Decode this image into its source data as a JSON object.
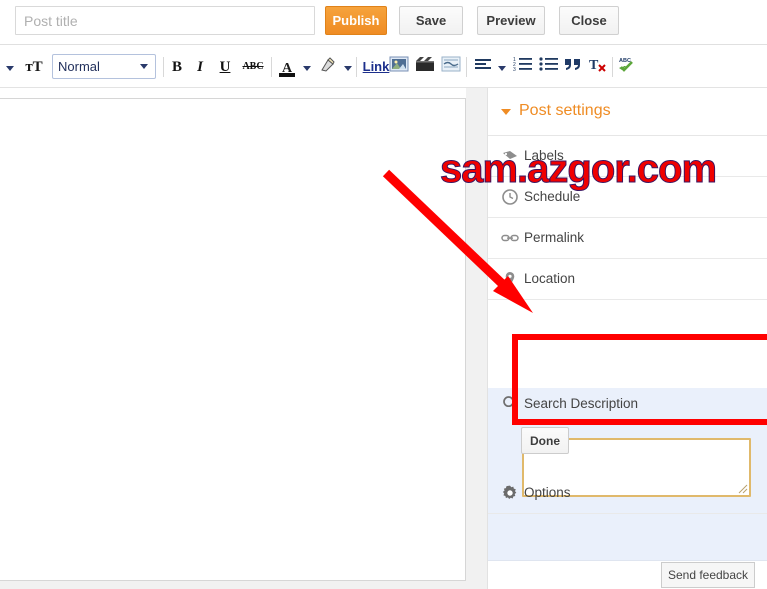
{
  "topbar": {
    "title_placeholder": "Post title",
    "title_value": "",
    "publish_label": "Publish",
    "save_label": "Save",
    "preview_label": "Preview",
    "close_label": "Close"
  },
  "toolbar": {
    "undo_icon": "undo-caret-icon",
    "font_family_icon": "font-family-icon",
    "font_size_value": "Normal",
    "bold_label": "B",
    "italic_label": "I",
    "underline_label": "U",
    "strikethrough_label": "ABC",
    "text_color_label": "A",
    "highlight_icon": "highlight-pen-icon",
    "link_label": "Link",
    "image_icon": "insert-image-icon",
    "video_icon": "insert-video-icon",
    "jump_break_icon": "jump-break-icon",
    "align_icon": "align-left-icon",
    "numbered_list_icon": "numbered-list-icon",
    "bullet_list_icon": "bullet-list-icon",
    "quote_icon": "blockquote-icon",
    "remove_format_icon": "remove-formatting-icon",
    "spellcheck_icon": "spellcheck-icon"
  },
  "sidebar": {
    "header_label": "Post settings",
    "rows": [
      {
        "label": "Labels",
        "icon": "label-tag-icon"
      },
      {
        "label": "Schedule",
        "icon": "clock-icon"
      },
      {
        "label": "Permalink",
        "icon": "link-chain-icon"
      },
      {
        "label": "Location",
        "icon": "map-pin-icon"
      }
    ],
    "search_description": {
      "label": "Search Description",
      "icon": "search-icon",
      "textarea_value": "",
      "done_label": "Done"
    },
    "options": {
      "label": "Options",
      "icon": "gear-icon"
    }
  },
  "footer": {
    "send_feedback_label": "Send feedback"
  },
  "annotations": {
    "watermark_text": "sam.azgor.com",
    "arrow_color": "#ff0000",
    "highlight_color": "#ff0000",
    "watermark_color": "#f00000"
  }
}
